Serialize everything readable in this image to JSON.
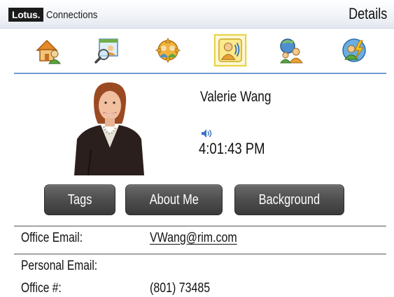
{
  "header": {
    "brand_logo": "Lotus.",
    "brand_product": "Connections",
    "screen_title": "Details"
  },
  "toolbar": {
    "items": [
      {
        "icon": "home-people-icon",
        "selected": false
      },
      {
        "icon": "search-directory-icon",
        "selected": false
      },
      {
        "icon": "communities-icon",
        "selected": false
      },
      {
        "icon": "profile-audio-icon",
        "selected": true
      },
      {
        "icon": "network-refresh-icon",
        "selected": false
      },
      {
        "icon": "activity-bolt-icon",
        "selected": false
      }
    ]
  },
  "profile": {
    "name": "Valerie Wang",
    "time_icon": "speaker-icon",
    "local_time": "4:01:43 PM"
  },
  "buttons": {
    "tags": "Tags",
    "about_me": "About Me",
    "background": "Background"
  },
  "fields": {
    "office_email_label": "Office Email:",
    "office_email_value": "VWang@rim.com",
    "personal_email_label": "Personal Email:",
    "personal_email_value": "",
    "office_phone_label": "Office #:",
    "office_phone_value": "(801) 73485"
  },
  "colors": {
    "accent_rule": "#6e9ad1",
    "selected_outline": "#e8d34a",
    "button_dark": "#4a4a4a"
  }
}
